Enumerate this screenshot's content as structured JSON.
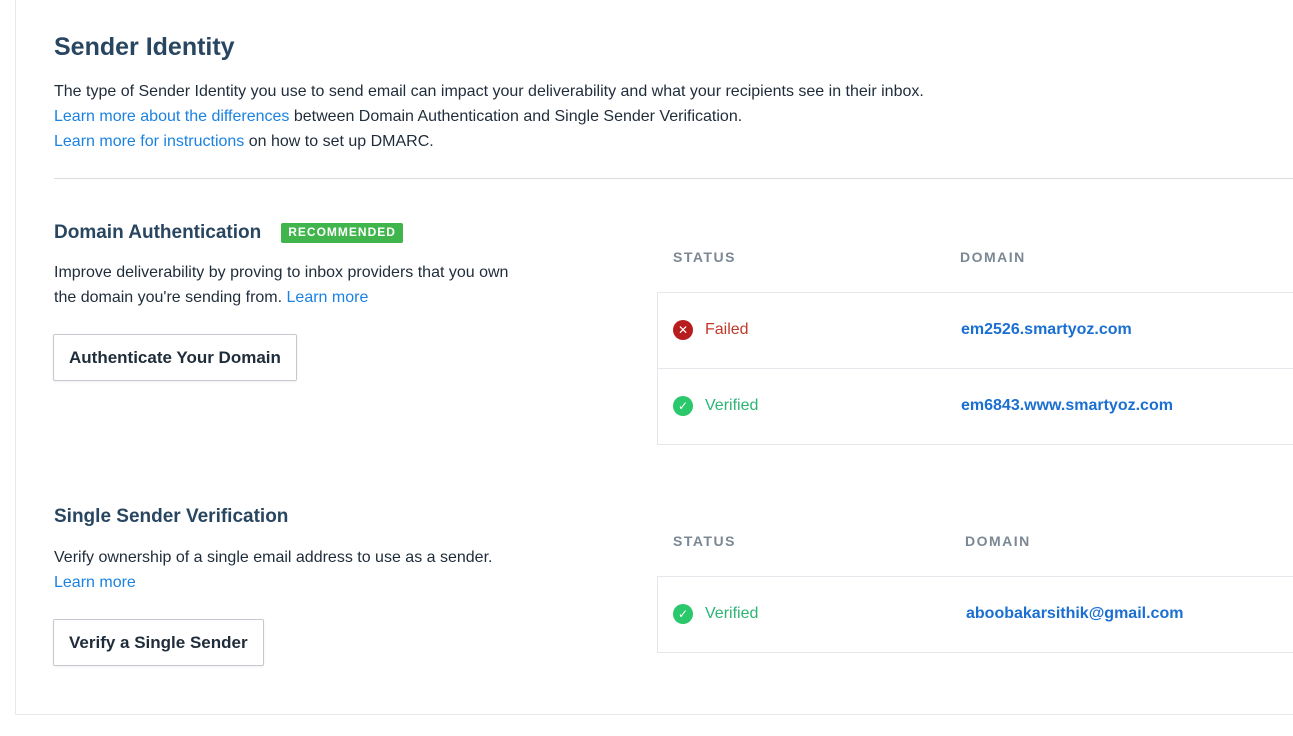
{
  "page": {
    "title": "Sender Identity",
    "intro_line1": "The type of Sender Identity you use to send email can impact your deliverability and what your recipients see in their inbox.",
    "intro_link2": "Learn more about the differences",
    "intro_text2": " between Domain Authentication and Single Sender Verification.",
    "intro_link3": "Learn more for instructions",
    "intro_text3": " on how to set up DMARC."
  },
  "domain_auth": {
    "title": "Domain Authentication",
    "badge": "RECOMMENDED",
    "desc_line1": "Improve deliverability by proving to inbox providers that you own",
    "desc_line2": "the domain you're sending from.",
    "learn_more": "Learn more",
    "button": "Authenticate Your Domain",
    "table": {
      "col_status": "STATUS",
      "col_domain": "DOMAIN",
      "rows": [
        {
          "status": "Failed",
          "status_icon": "x-circle-icon",
          "domain": "em2526.smartyoz.com"
        },
        {
          "status": "Verified",
          "status_icon": "check-circle-icon",
          "domain": "em6843.www.smartyoz.com"
        }
      ]
    }
  },
  "single_sender": {
    "title": "Single Sender Verification",
    "desc_line1": "Verify ownership of a single email address to use as a sender.",
    "learn_more": "Learn more",
    "button": "Verify a Single Sender",
    "table": {
      "col_status": "STATUS",
      "col_domain": "DOMAIN",
      "rows": [
        {
          "status": "Verified",
          "status_icon": "check-circle-icon",
          "domain": "aboobakarsithik@gmail.com"
        }
      ]
    }
  },
  "colors": {
    "heading": "#294661",
    "link": "#1a82e2",
    "badge": "#3fb54c",
    "failed": "#b81d1d",
    "verified": "#2bc76b"
  }
}
